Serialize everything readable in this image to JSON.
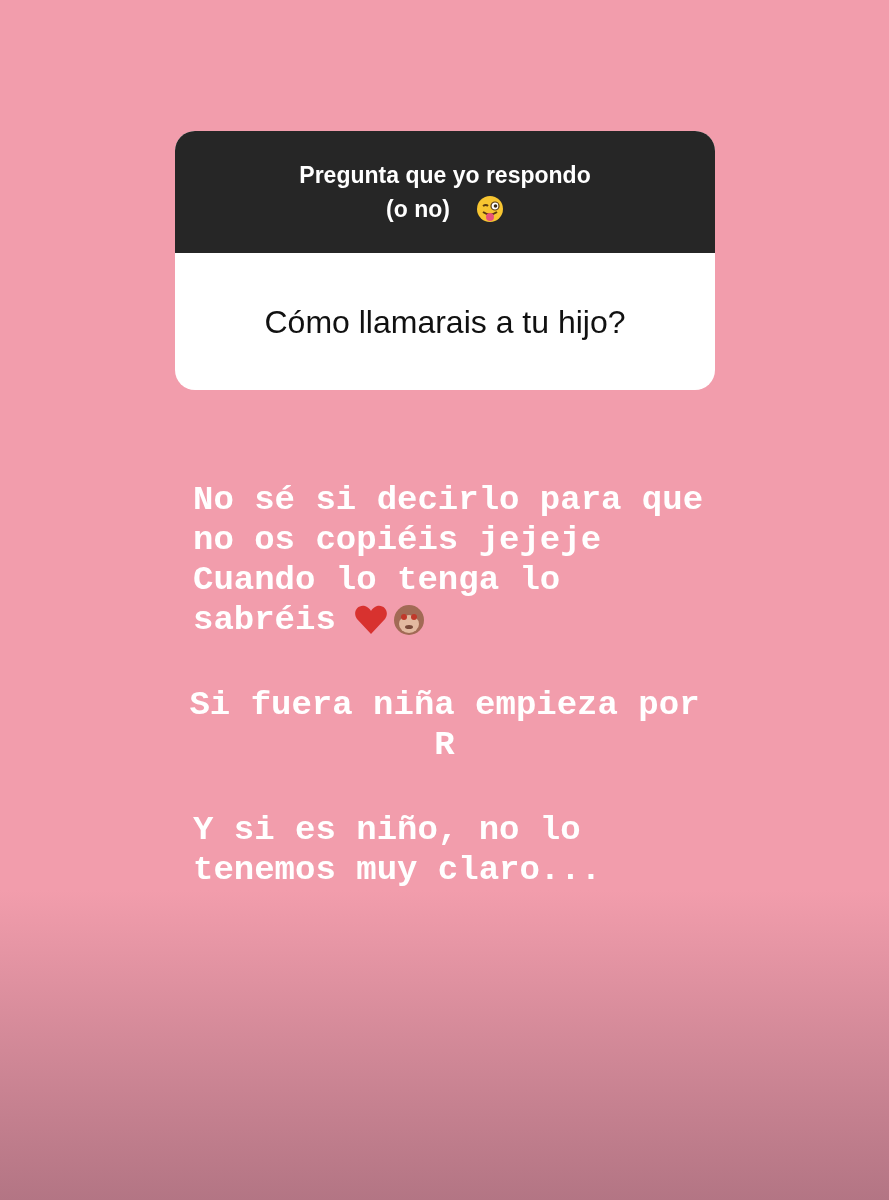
{
  "question_sticker": {
    "prompt_lines": [
      {
        "text": "Pregunta que yo respondo",
        "kind": "plain"
      },
      {
        "text": "(o no)",
        "kind": "wink"
      }
    ],
    "question": "Cómo llamarais a tu hijo?"
  },
  "replies": [
    {
      "kind": "left",
      "lines": [
        {
          "text": "No sé si decirlo para que",
          "kind": "plain"
        },
        {
          "text": "no os copiéis jejeje",
          "kind": "plain"
        },
        {
          "text": "Cuando lo tenga lo",
          "kind": "plain"
        },
        {
          "text": "sabréis",
          "kind": "heartmonkey"
        }
      ]
    },
    {
      "kind": "centered",
      "lines": [
        {
          "text": "Si fuera niña empieza por",
          "kind": "plain"
        },
        {
          "text": "R",
          "kind": "plain"
        }
      ]
    },
    {
      "kind": "left",
      "lines": [
        {
          "text": "Y si es niño, no lo",
          "kind": "plain"
        },
        {
          "text": "tenemos muy claro...",
          "kind": "plain"
        }
      ]
    }
  ]
}
